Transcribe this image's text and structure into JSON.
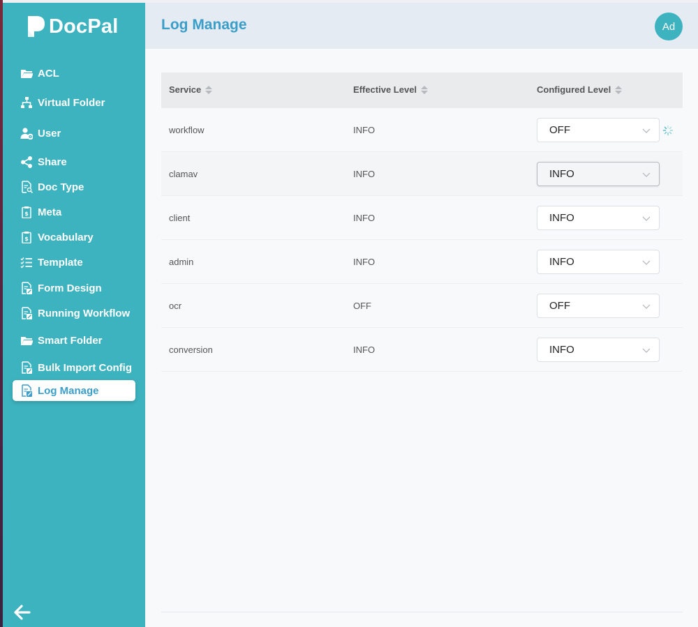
{
  "brand": {
    "name": "DocPal"
  },
  "sidebar": {
    "items": [
      {
        "label": "ACL",
        "icon": "folder-open-icon"
      },
      {
        "label": "Virtual Folder",
        "icon": "sitemap-icon"
      },
      {
        "label": "User",
        "icon": "user-cog-icon"
      },
      {
        "label": "Share",
        "icon": "share-icon"
      },
      {
        "label": "Doc Type",
        "icon": "document-search-icon"
      },
      {
        "label": "Meta",
        "icon": "clipboard-dollar-icon"
      },
      {
        "label": "Vocabulary",
        "icon": "clipboard-dollar-icon"
      },
      {
        "label": "Template",
        "icon": "checklist-icon"
      },
      {
        "label": "Form Design",
        "icon": "document-edit-icon"
      },
      {
        "label": "Running Workflow",
        "icon": "document-edit-icon"
      },
      {
        "label": "Smart Folder",
        "icon": "folder-open-icon"
      },
      {
        "label": "Bulk Import Config",
        "icon": "document-edit-icon"
      },
      {
        "label": "Log Manage",
        "icon": "document-edit-icon"
      }
    ],
    "active_item": "Log Manage"
  },
  "header": {
    "title": "Log Manage",
    "avatar_initials": "Ad"
  },
  "table": {
    "columns": [
      "Service",
      "Effective Level",
      "Configured Level"
    ],
    "rows": [
      {
        "service": "workflow",
        "effective": "INFO",
        "configured": "OFF",
        "loading": true
      },
      {
        "service": "clamav",
        "effective": "INFO",
        "configured": "INFO",
        "loading": false
      },
      {
        "service": "client",
        "effective": "INFO",
        "configured": "INFO",
        "loading": false
      },
      {
        "service": "admin",
        "effective": "INFO",
        "configured": "INFO",
        "loading": false
      },
      {
        "service": "ocr",
        "effective": "OFF",
        "configured": "OFF",
        "loading": false
      },
      {
        "service": "conversion",
        "effective": "INFO",
        "configured": "INFO",
        "loading": false
      }
    ]
  },
  "colors": {
    "sidebar": "#3db3bf",
    "accent": "#3a9ec9",
    "header_bg": "#e4ebf2"
  }
}
